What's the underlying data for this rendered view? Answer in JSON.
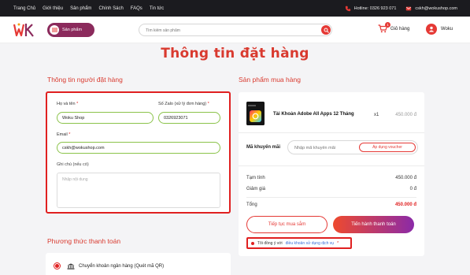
{
  "topbar": {
    "nav": [
      "Trang Chủ",
      "Giới thiệu",
      "Sản phẩm",
      "Chính Sách",
      "FAQs",
      "Tin tức"
    ],
    "hotline": "Hotline: 0326 923 071",
    "email": "cskh@wokushop.com"
  },
  "header": {
    "category_label": "Sản phẩm",
    "search_placeholder": "Tìm kiếm sản phẩm",
    "cart_label": "Giỏ hàng",
    "cart_count": "1",
    "user_label": "Woku"
  },
  "page_title": "Thông tin đặt hàng",
  "customer": {
    "heading": "Thông tin người đặt hàng",
    "name_label": "Họ và tên",
    "name_value": "Woku Shop",
    "zalo_label": "Số Zalo (xử lý đơn hàng)",
    "zalo_value": "0326923071",
    "email_label": "Email",
    "email_value": "cskh@wokushop.com",
    "note_label": "Ghi chú (nếu có)",
    "note_placeholder": "Nhập nội dung",
    "required_mark": "*"
  },
  "payment": {
    "heading": "Phương thức thanh toán",
    "option_label": "Chuyển khoản ngân hàng (Quét mã QR)"
  },
  "order": {
    "heading": "Sản phẩm mua hàng",
    "product_name": "Tài Khoản Adobe All Apps 12 Tháng",
    "quantity": "x1",
    "price": "450.000 đ",
    "coupon_label": "Mã khuyến mãi",
    "coupon_placeholder": "Nhập mã khuyến mãi",
    "coupon_button": "Áp dụng voucher",
    "subtotal_label": "Tạm tính",
    "subtotal_value": "450.000 đ",
    "discount_label": "Giảm giá",
    "discount_value": "0 đ",
    "total_label": "Tổng",
    "total_value": "450.000 đ",
    "continue_button": "Tiếp tục mua sắm",
    "checkout_button": "Tiến hành thanh toán",
    "terms_prefix": "Tôi đồng ý với",
    "terms_link": "điều khoản sử dụng dịch vụ",
    "terms_required": "*"
  },
  "colors": {
    "accent": "#d93a2f",
    "highlight_border": "#e02020",
    "topbar_bg": "#1b1b1f",
    "category_button": "#8b2a5c"
  }
}
